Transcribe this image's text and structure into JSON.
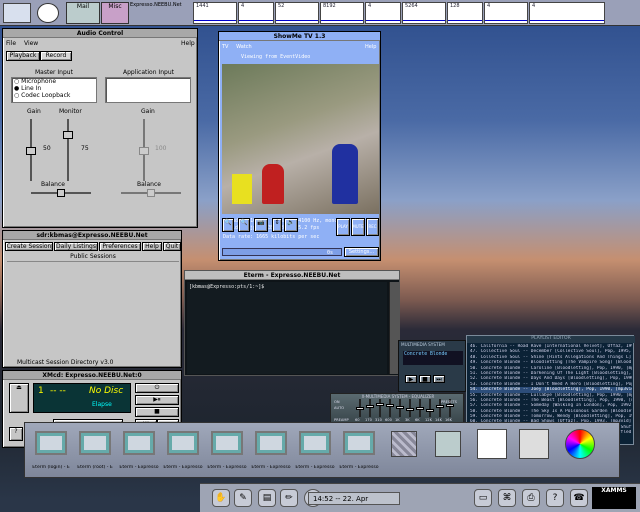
{
  "topbar": {
    "mail_label": "Mail",
    "misc_label": "Misc",
    "host_label": "Expresso.NEEBU.Net",
    "graphs": [
      "1441",
      "4",
      "52",
      "8192",
      "4",
      "5264",
      "128",
      "4",
      "4"
    ]
  },
  "audio": {
    "title": "Audio Control",
    "menu": {
      "file": "File",
      "view": "View",
      "help": "Help"
    },
    "tabs": {
      "playback": "Playback",
      "record": "Record"
    },
    "master_input": "Master Input",
    "app_input": "Application Input",
    "inputs": [
      "Microphone",
      "Line In",
      "Codec Loopback"
    ],
    "gain": "Gain",
    "monitor": "Monitor",
    "balance": "Balance",
    "gain_val": "50",
    "monitor_val": "75",
    "app_gain_val": "100"
  },
  "sdr": {
    "title": "sdr:kbmas@Expresso.NEEBU.Net",
    "menu": [
      "Create Session",
      "Daily Listings",
      "Preferences",
      "Help",
      "Quit"
    ],
    "public_sessions": "Public Sessions",
    "footer": "Multicast Session Directory v3.0"
  },
  "xmcd": {
    "title": "XMcd: Expresso.NEEBU.Net:0",
    "track": "1",
    "time": "-- --",
    "status": "No Disc",
    "mode": "Elapse"
  },
  "tv": {
    "title": "ShowMe TV 1.3",
    "menu": {
      "tv": "TV",
      "watch": "Watch",
      "help": "Help"
    },
    "status": "Viewing from EventVideo",
    "info1": "Audio: 16 bit linear, 44100 Hz, mono",
    "info2": "Video: jpeg, 352x288, 25.2 fps",
    "info3": "Data rate: 1665 kilobits per sec",
    "btn_play": "PLAY",
    "btn_mute": "MUTE",
    "btn_rec": "REC",
    "settings": "Settings...",
    "progress": "0s"
  },
  "term": {
    "title": "Eterm - Expresso.NEEBU.Net",
    "prompt": "[kbmas@Expresso:pts/1:~]$"
  },
  "playlist": {
    "header": "PLAYLIST EDITOR",
    "rows": [
      "46. California -- Road Rave [International Velvet], Offaz, 1998, [mp3vid](http://  3:42",
      "47. Collective Soul -- December [Collective Soul], Pop, 1995, [mp3vid](http://...  5:07",
      "48. Collective Soul -- Shine [Hints Allegations And Things L], Pop, 1993, [mp3vi...  5:06",
      "49. Concrete Blonde -- Bloodletting (The Vampire Song) [Bloodletting], Pop, 1990  5:34",
      "50. Concrete Blonde -- Caroline [Bloodletting], Pop, 1990, [mp3vid](http://  4:07",
      "51. Concrete Blonde -- Darkening Of The Light [Bloodletting], Pop, 1990, [mp3vid] 4:41",
      "52. Concrete Blonde -- Days And Days [Bloodletting], Pop, 1990, [mp3vid](http:// 4:04",
      "53. Concrete Blonde -- I Don't Need A Hero [Bloodletting], Pop, 1990 [mp3vid]  4:49",
      "54. Concrete Blonde -- Joey [Bloodletting], Pop, 1990, [mp3vid](http://...  3:48",
      "55. Concrete Blonde -- Lullabye [Bloodletting], Pop, 1990, [mp3vid](http://  4:54",
      "56. Concrete Blonde -- The Beast [Bloodletting], Pop, 1990, [mp3vid](http://  3:58",
      "57. Concrete Blonde -- Someday [Walking In London], Pop, 1992, [mp3vid]  4:17",
      "58. Concrete Blonde -- The Sky Is A Poisonous Garden [Bloodletting], Pop, 1990  3:52",
      "59. Concrete Blonde -- Tomorrow, Wendy [Bloodletting], Pop, 1990, [mp3vid]  3:57",
      "60. Concrete Blonde -- Bad Shows [Offaz], Pop, 1993, [mp3vid](http://  4:31",
      "61. Crash Test Dummies -- Afternoons & Coffeespoons [God Shuffled His Feet]  3:58",
      "62. Crash Test Dummies -- God Shuffled His Feet [God Shuffled His Feet], Pop  5:11"
    ],
    "footer": "-0:00:00/1:12:00"
  },
  "winamp": {
    "label": "MULTIMEDIA SYSTEM",
    "title": "Concrete Blonde",
    "eq_label": "X-MULTIMEDIA SYSTEM - EQUALIZER",
    "on": "ON",
    "auto": "AUTO",
    "presets": "PRESETS",
    "preamp": "PREAMP",
    "bands": [
      "60",
      "170",
      "310",
      "600",
      "1K",
      "3K",
      "6K",
      "12K",
      "14K",
      "16K"
    ]
  },
  "dock": {
    "items": [
      "Eterm (login) - E",
      "Eterm (root) - E",
      "Eterm - Expresso",
      "Eterm - Expresso",
      "Eterm - Expresso",
      "Eterm - Expresso",
      "Eterm - Expresso",
      "Eterm - Expresso"
    ]
  },
  "tray": {
    "clock": "14:52 -- 22. Apr",
    "brand": "XAMMS"
  }
}
